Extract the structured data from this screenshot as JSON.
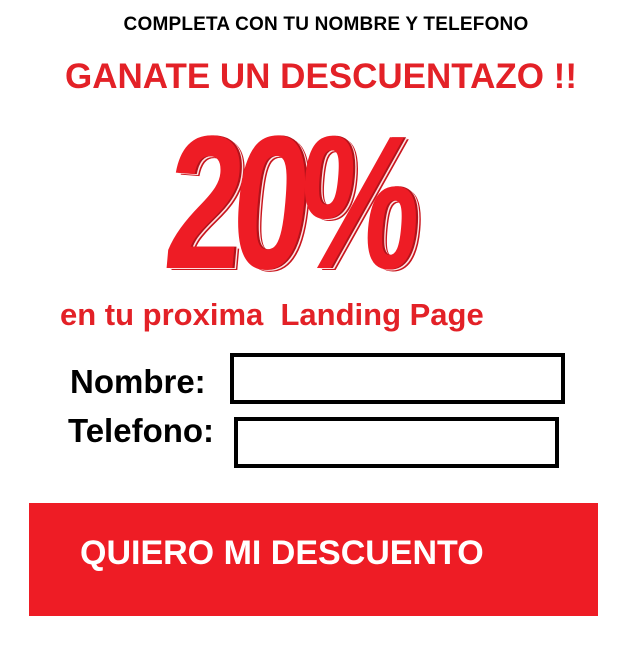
{
  "promo": {
    "instruction": "COMPLETA CON TU NOMBRE Y TELEFONO",
    "headline": "GANATE UN DESCUENTAZO !!",
    "discount": "20%",
    "subline": "en tu proxima  Landing Page"
  },
  "form": {
    "name_label": "Nombre:",
    "name_value": "",
    "phone_label": "Telefono:",
    "phone_value": ""
  },
  "cta": {
    "label": "QUIERO MI DESCUENTO"
  },
  "colors": {
    "accent_red": "#ee1c25",
    "headline_red": "#e32127",
    "background": "#ffffff",
    "text": "#000000"
  }
}
